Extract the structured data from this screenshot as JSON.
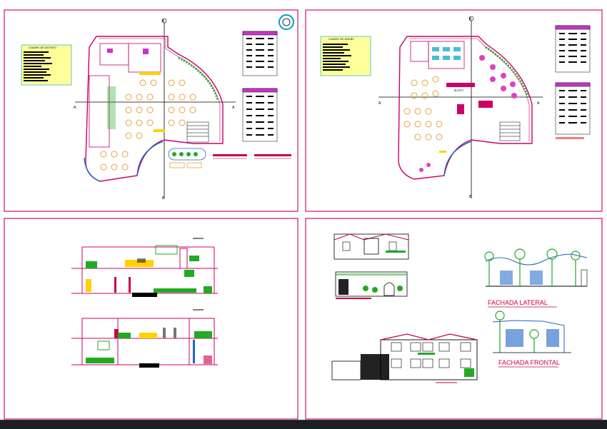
{
  "colors": {
    "background": "#ffffff",
    "frame": "#d6247a",
    "wall": "#cc0066",
    "axis": "#000000",
    "furniture": "#e6a23c",
    "vegetation": "#22aa22",
    "glass": "#1e64c8",
    "table": "#000000",
    "highlight": "#ffff99"
  },
  "plan1": {
    "legend_title": "CUADRO DE DISTRITO",
    "axis_top": "B",
    "axis_bottom": "B",
    "axis_left": "A",
    "axis_right": "A"
  },
  "plan2": {
    "legend_title": "CUADRO DE DISEÑO",
    "axis_top": "B",
    "axis_bottom": "B",
    "axis_left": "A",
    "axis_right": "A",
    "room_label": "BUFFET"
  },
  "elevations": {
    "lateral_title": "FACHADA LATERAL",
    "frontal_title": "FACHADA FRONTAL"
  },
  "taskbar": {
    "label": ""
  }
}
